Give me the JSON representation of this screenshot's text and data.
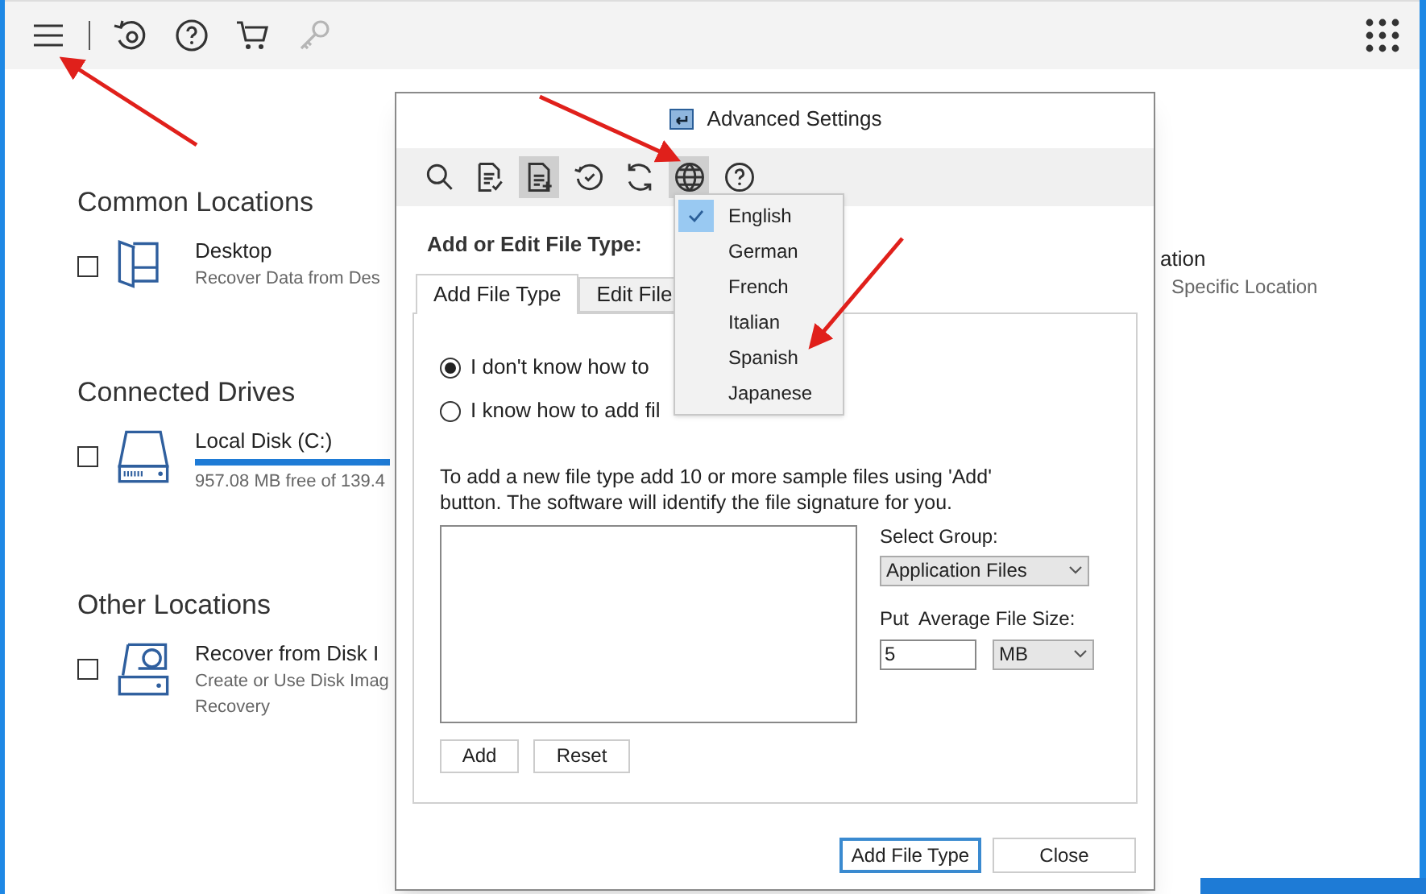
{
  "toolbar": {
    "tools": [
      {
        "kind": "menu",
        "disabled": false
      },
      {
        "kind": "history",
        "disabled": false
      },
      {
        "kind": "help",
        "disabled": false
      },
      {
        "kind": "cart",
        "disabled": false
      },
      {
        "kind": "key",
        "disabled": true
      },
      {
        "kind": "apps",
        "disabled": false
      }
    ]
  },
  "sections": [
    {
      "title": "Common Locations",
      "items": [
        {
          "kind": "folder",
          "title": "Desktop",
          "description": "Recover Data from Des",
          "checked": false
        }
      ]
    },
    {
      "title": "Connected Drives",
      "items": [
        {
          "kind": "drive",
          "title": "Local Disk (C:)",
          "description": "957.08 MB free of 139.4",
          "checked": false
        }
      ]
    },
    {
      "title": "Other Locations",
      "items": [
        {
          "kind": "image",
          "title": "Recover from Disk I",
          "description": "Create or Use Disk Imag",
          "description_2": "Recovery",
          "checked": false
        }
      ]
    }
  ],
  "right_item": {
    "title": "ation",
    "description": "Specific Location"
  },
  "dialog": {
    "title": "Advanced Settings",
    "tools": [
      {
        "kind": "search",
        "active": false
      },
      {
        "kind": "doc-check",
        "active": false
      },
      {
        "kind": "doc-plus",
        "active": true
      },
      {
        "kind": "clock-check",
        "active": false
      },
      {
        "kind": "refresh",
        "active": false
      },
      {
        "kind": "globe",
        "active": true
      },
      {
        "kind": "help",
        "active": false
      }
    ],
    "heading": "Add or Edit File Type:",
    "tabs": [
      {
        "label": "Add File Type",
        "selected": true
      },
      {
        "label": "Edit File",
        "selected": false
      }
    ],
    "radios": [
      {
        "label": "I don't know how to",
        "selected": true
      },
      {
        "label": "I know how to add fil",
        "selected": false
      }
    ],
    "instructions": "To add a new file type add 10 or more sample files using 'Add' button. The software will identify the file signature for you.",
    "group_label": "Select Group:",
    "group_value": "Application Files",
    "size_label": "Put  Average File Size:",
    "size_value": "5",
    "unit_value": "MB",
    "list_buttons": [
      "Add",
      "Reset"
    ],
    "footer_buttons": [
      {
        "label": "Add File Type",
        "default": true
      },
      {
        "label": "Close",
        "default": false
      }
    ]
  },
  "language_menu": {
    "items": [
      {
        "label": "English",
        "selected": true
      },
      {
        "label": "German",
        "selected": false
      },
      {
        "label": "French",
        "selected": false
      },
      {
        "label": "Italian",
        "selected": false
      },
      {
        "label": "Spanish",
        "selected": false
      },
      {
        "label": "Japanese",
        "selected": false
      }
    ]
  }
}
